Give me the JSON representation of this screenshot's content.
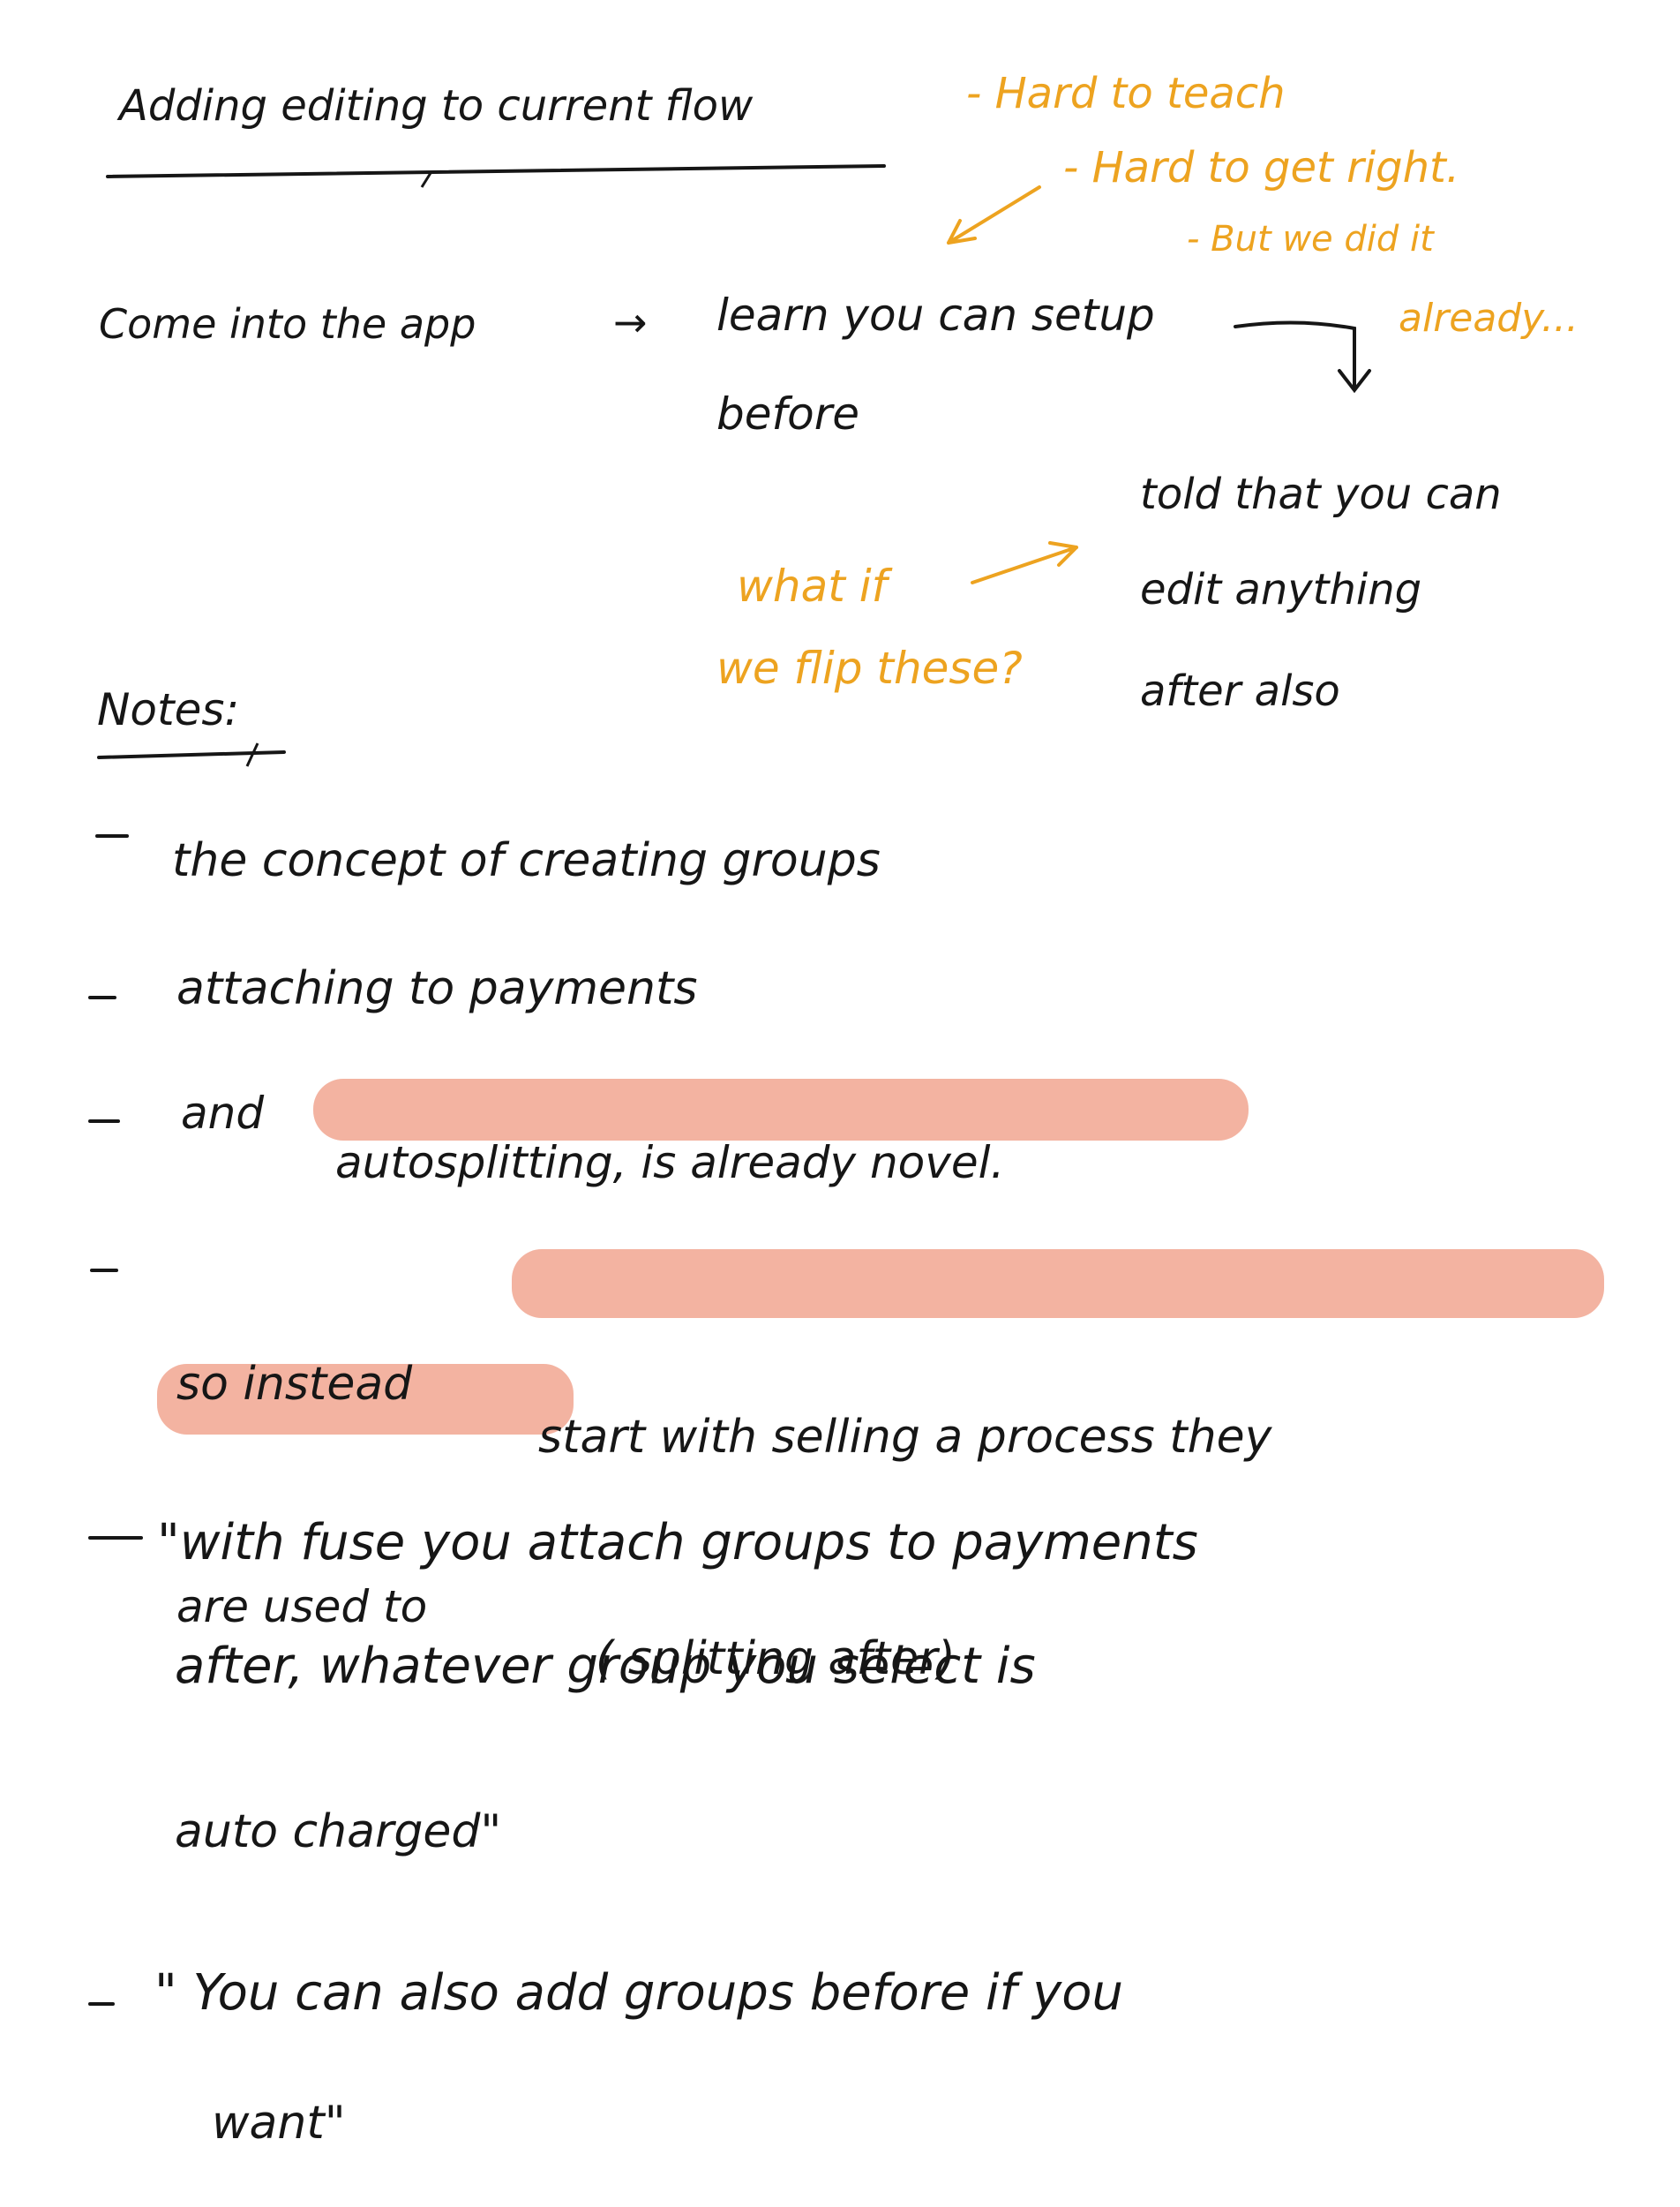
{
  "title": "Adding editing to current flow",
  "orange_notes": {
    "line1": "- Hard to teach",
    "line2": "- Hard to get right.",
    "line3": "- But we did it",
    "line4": "already..."
  },
  "flow": {
    "step1": "Come into the app",
    "arrow": "→",
    "step2_line1": "learn you can setup",
    "step2_line2": "before",
    "step3_line1": "told that you can",
    "step3_line2": "edit anything",
    "step3_line3": "after also"
  },
  "question": {
    "line1": "what if",
    "line2": "we flip these?"
  },
  "notes_heading": "Notes:",
  "notes": {
    "n1": "the concept of creating groups",
    "n2": "attaching to payments",
    "n3_pre": "and",
    "n3_hl": "autosplitting, is already novel.",
    "n4_pre": "so instead",
    "n4_hl": "start with selling a process they",
    "n4b_hl": "are used to",
    "n4b_post": "( splitting after)",
    "n5_l1": "\"with fuse you attach groups to payments",
    "n5_l2": "after, whatever group you select is",
    "n5_l3": "auto charged\"",
    "n6_l1": "\" You can also add groups before if you",
    "n6_l2": "want\""
  },
  "colors": {
    "ink": "#161616",
    "accent_orange": "#eda320",
    "highlight_salmon": "#f3b3a1",
    "paper": "#ffffff"
  }
}
